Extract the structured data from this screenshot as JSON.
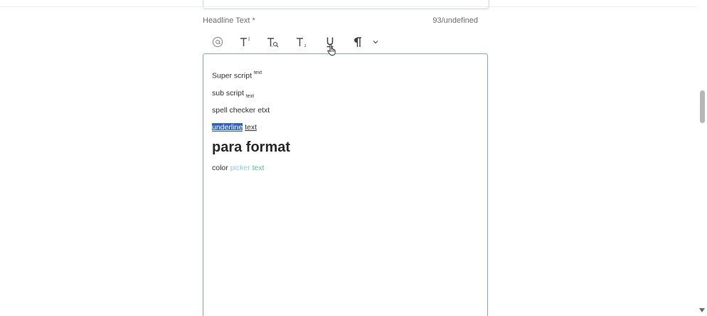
{
  "field": {
    "label": "Headline Text *",
    "char_count": "93/undefined"
  },
  "toolbar": {
    "items": [
      {
        "name": "mention-button",
        "icon": "at-icon",
        "glyph": "@"
      },
      {
        "name": "superscript-button",
        "icon": "superscript-icon"
      },
      {
        "name": "spellcheck-button",
        "icon": "spellcheck-icon"
      },
      {
        "name": "subscript-button",
        "icon": "subscript-icon"
      },
      {
        "name": "underline-button",
        "icon": "underline-icon"
      },
      {
        "name": "paragraph-format-button",
        "icon": "pilcrow-icon",
        "glyph": "¶"
      },
      {
        "name": "more-options-button",
        "icon": "chevron-down-icon"
      }
    ]
  },
  "editor": {
    "line1": {
      "text": "Super script ",
      "sup": "text"
    },
    "line2": {
      "text": "sub script ",
      "sub": "text"
    },
    "line3": {
      "text": "spell checker etxt"
    },
    "line4": {
      "selected": "underline",
      "rest": "text"
    },
    "line5": {
      "text": "para format"
    },
    "line6": {
      "text": "color ",
      "blue": "picker",
      "green": "text"
    }
  },
  "colors": {
    "selection": "#2f63c8",
    "picker_blue": "#8fc9ea",
    "picker_green": "#52c38a",
    "editor_border": "#7ea6d6"
  }
}
